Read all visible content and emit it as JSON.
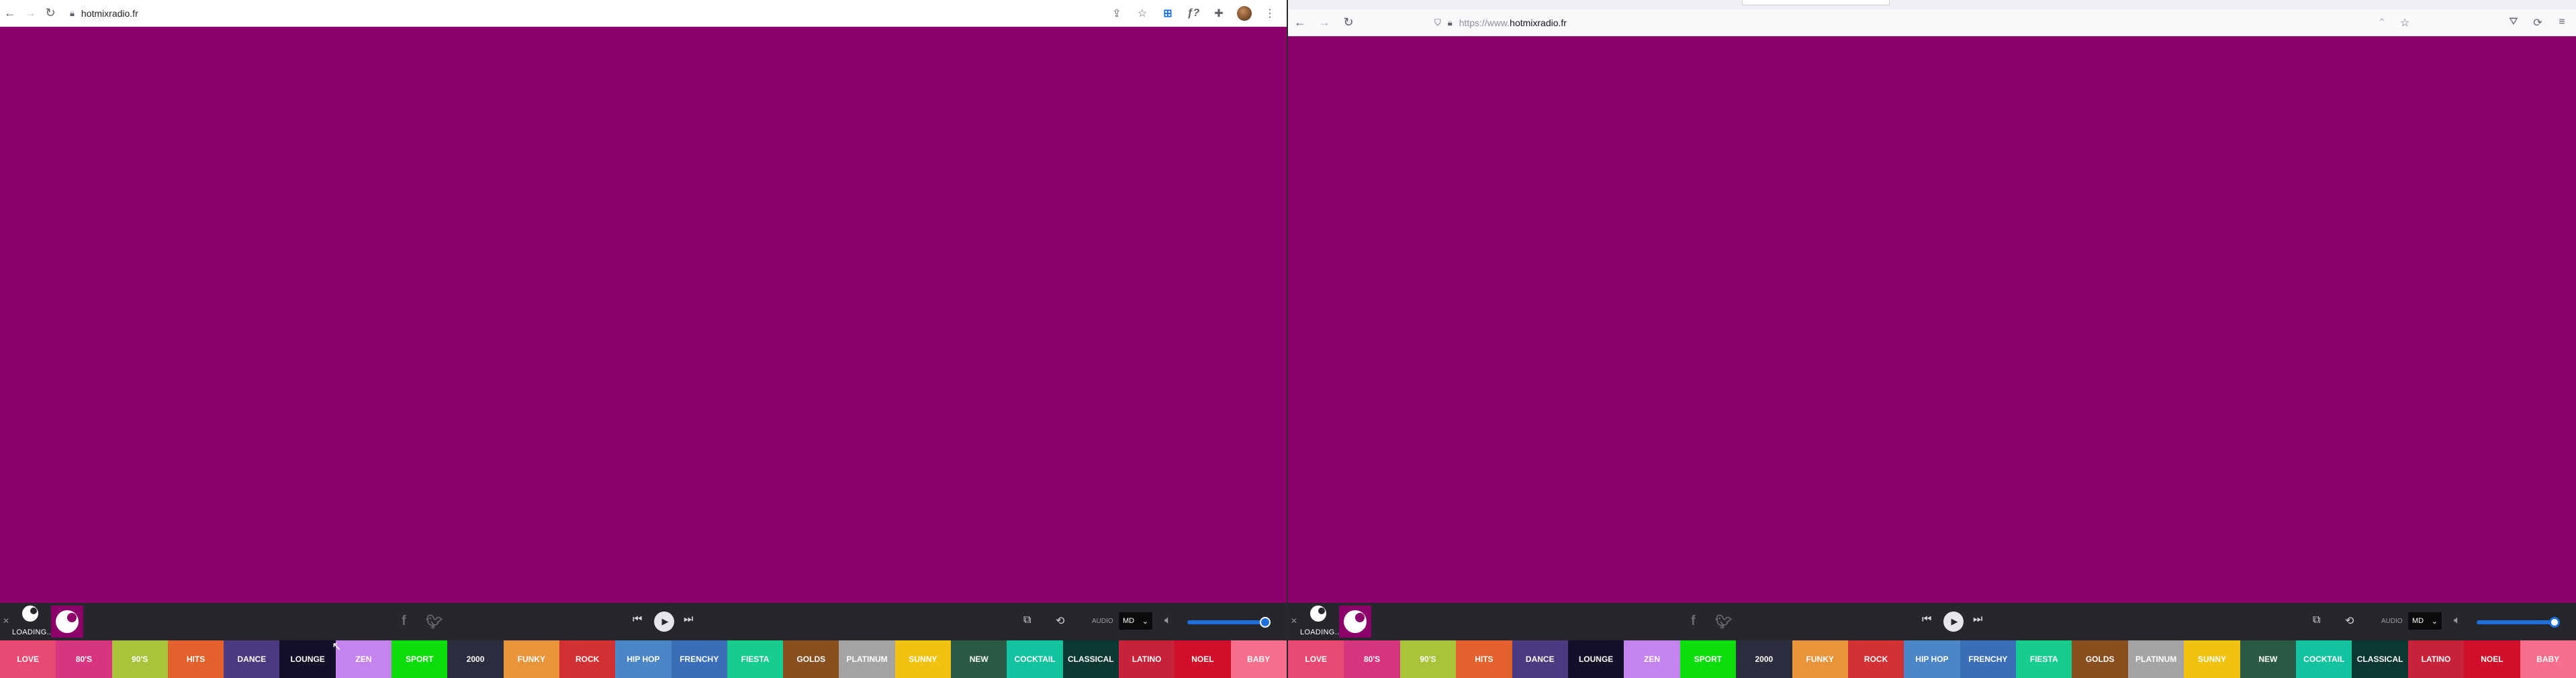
{
  "left_browser": {
    "url": "hotmixradio.fr",
    "toolbar_icons": [
      "back-icon",
      "forward-icon",
      "reload-icon",
      "lock-icon",
      "share-icon",
      "star-icon",
      "extension-translate-icon",
      "font-icon",
      "puzzle-icon",
      "profile-avatar",
      "menu-icon"
    ],
    "ext_label": "ƒ?"
  },
  "right_browser": {
    "url_prefix": "https://www.",
    "url_domain": "hotmixradio.fr",
    "toolbar_icons": [
      "back-icon",
      "forward-icon",
      "reload-icon",
      "shield-icon",
      "lock-icon",
      "translate-icon",
      "star-icon",
      "pocket-icon",
      "sync-icon",
      "menu-icon"
    ]
  },
  "page": {
    "background": "#8b0069"
  },
  "player": {
    "status": "LOADING",
    "audio_label": "AUDIO",
    "quality": "MD",
    "volume_percent": 100
  },
  "genres": [
    {
      "label": "LOVE",
      "color": "#e84a73"
    },
    {
      "label": "80'S",
      "color": "#d7357f"
    },
    {
      "label": "90'S",
      "color": "#a8c43a"
    },
    {
      "label": "HITS",
      "color": "#e2612c"
    },
    {
      "label": "DANCE",
      "color": "#4c3a80"
    },
    {
      "label": "LOUNGE",
      "color": "#14102a"
    },
    {
      "label": "ZEN",
      "color": "#c484ee"
    },
    {
      "label": "SPORT",
      "color": "#0bdc0b"
    },
    {
      "label": "2000",
      "color": "#2c2d3e"
    },
    {
      "label": "FUNKY",
      "color": "#e8943a"
    },
    {
      "label": "ROCK",
      "color": "#d23032"
    },
    {
      "label": "HIP HOP",
      "color": "#4b86c6"
    },
    {
      "label": "FRENCHY",
      "color": "#3a6eb8"
    },
    {
      "label": "FIESTA",
      "color": "#16cc8f"
    },
    {
      "label": "GOLDS",
      "color": "#8a4f1f"
    },
    {
      "label": "PLATINUM",
      "color": "#a4a4a4"
    },
    {
      "label": "SUNNY",
      "color": "#f2c211"
    },
    {
      "label": "NEW",
      "color": "#2b5a44"
    },
    {
      "label": "COCKTAIL",
      "color": "#12c3a0"
    },
    {
      "label": "CLASSICAL",
      "color": "#0b3833"
    },
    {
      "label": "LATINO",
      "color": "#c8223a"
    },
    {
      "label": "NOEL",
      "color": "#d0102a"
    },
    {
      "label": "BABY",
      "color": "#f86f8e"
    }
  ]
}
